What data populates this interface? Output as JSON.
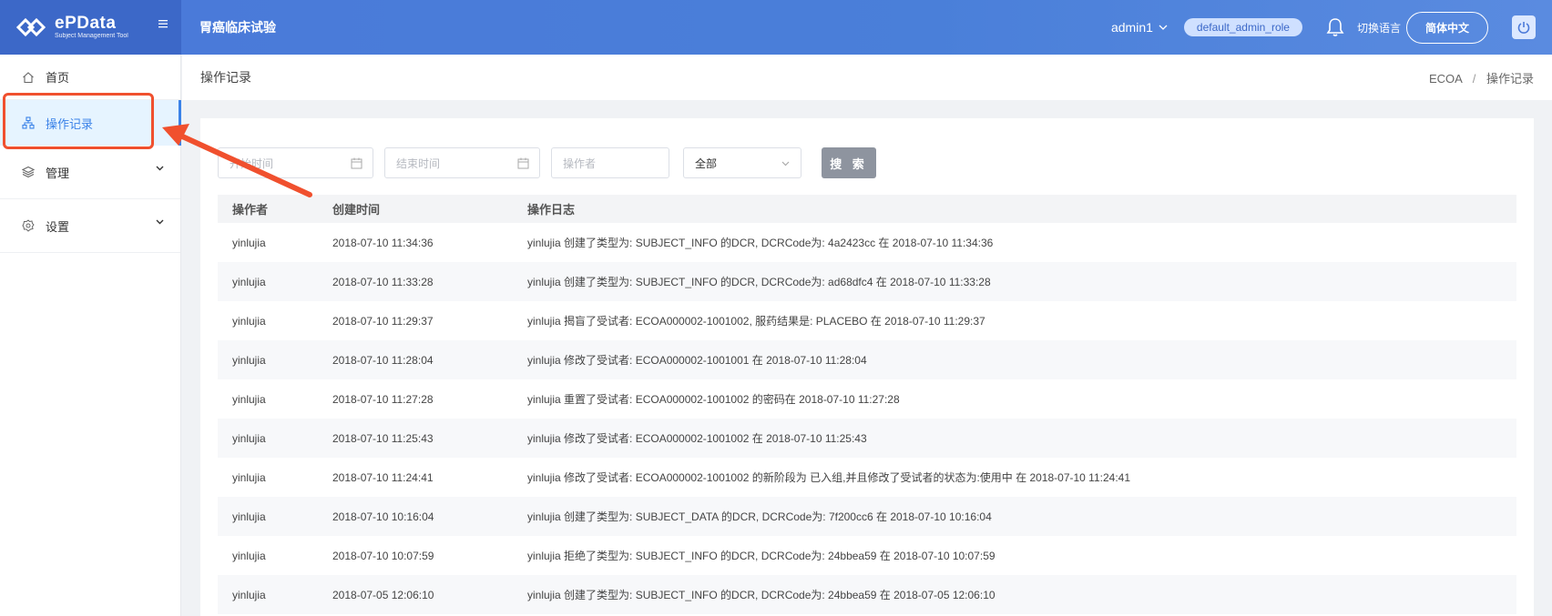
{
  "header": {
    "logo_name": "ePData",
    "logo_sub": "Subject Management Tool",
    "project_title": "胃癌临床试验",
    "user_name": "admin1",
    "role": "default_admin_role",
    "lang_label": "切换语言",
    "lang_button": "简体中文"
  },
  "sidebar": {
    "items": [
      {
        "label": "首页"
      },
      {
        "label": "操作记录"
      },
      {
        "label": "管理"
      },
      {
        "label": "设置"
      }
    ]
  },
  "page": {
    "title": "操作记录",
    "breadcrumb": [
      "ECOA",
      "操作记录"
    ]
  },
  "filters": {
    "start_placeholder": "开始时间",
    "end_placeholder": "结束时间",
    "operator_placeholder": "操作者",
    "select_value": "全部",
    "search_label": "搜 索"
  },
  "table": {
    "headers": [
      "操作者",
      "创建时间",
      "操作日志"
    ],
    "rows": [
      [
        "yinlujia",
        "2018-07-10 11:34:36",
        "yinlujia 创建了类型为: SUBJECT_INFO 的DCR, DCRCode为: 4a2423cc 在 2018-07-10 11:34:36"
      ],
      [
        "yinlujia",
        "2018-07-10 11:33:28",
        "yinlujia 创建了类型为: SUBJECT_INFO 的DCR, DCRCode为: ad68dfc4 在 2018-07-10 11:33:28"
      ],
      [
        "yinlujia",
        "2018-07-10 11:29:37",
        "yinlujia 揭盲了受试者: ECOA000002-1001002, 服药结果是: PLACEBO 在 2018-07-10 11:29:37"
      ],
      [
        "yinlujia",
        "2018-07-10 11:28:04",
        "yinlujia 修改了受试者: ECOA000002-1001001 在 2018-07-10 11:28:04"
      ],
      [
        "yinlujia",
        "2018-07-10 11:27:28",
        "yinlujia 重置了受试者: ECOA000002-1001002 的密码在 2018-07-10 11:27:28"
      ],
      [
        "yinlujia",
        "2018-07-10 11:25:43",
        "yinlujia 修改了受试者: ECOA000002-1001002 在 2018-07-10 11:25:43"
      ],
      [
        "yinlujia",
        "2018-07-10 11:24:41",
        "yinlujia 修改了受试者: ECOA000002-1001002 的新阶段为 已入组,并且修改了受试者的状态为:使用中 在 2018-07-10 11:24:41"
      ],
      [
        "yinlujia",
        "2018-07-10 10:16:04",
        "yinlujia 创建了类型为: SUBJECT_DATA 的DCR, DCRCode为: 7f200cc6 在 2018-07-10 10:16:04"
      ],
      [
        "yinlujia",
        "2018-07-10 10:07:59",
        "yinlujia 拒绝了类型为: SUBJECT_INFO 的DCR, DCRCode为: 24bbea59 在 2018-07-10 10:07:59"
      ],
      [
        "yinlujia",
        "2018-07-05 12:06:10",
        "yinlujia 创建了类型为: SUBJECT_INFO 的DCR, DCRCode为: 24bbea59 在 2018-07-05 12:06:10"
      ]
    ]
  },
  "colors": {
    "header_blue": "#4a79d9",
    "active_blue": "#3a82e8",
    "annotation_red": "#f0502e"
  }
}
